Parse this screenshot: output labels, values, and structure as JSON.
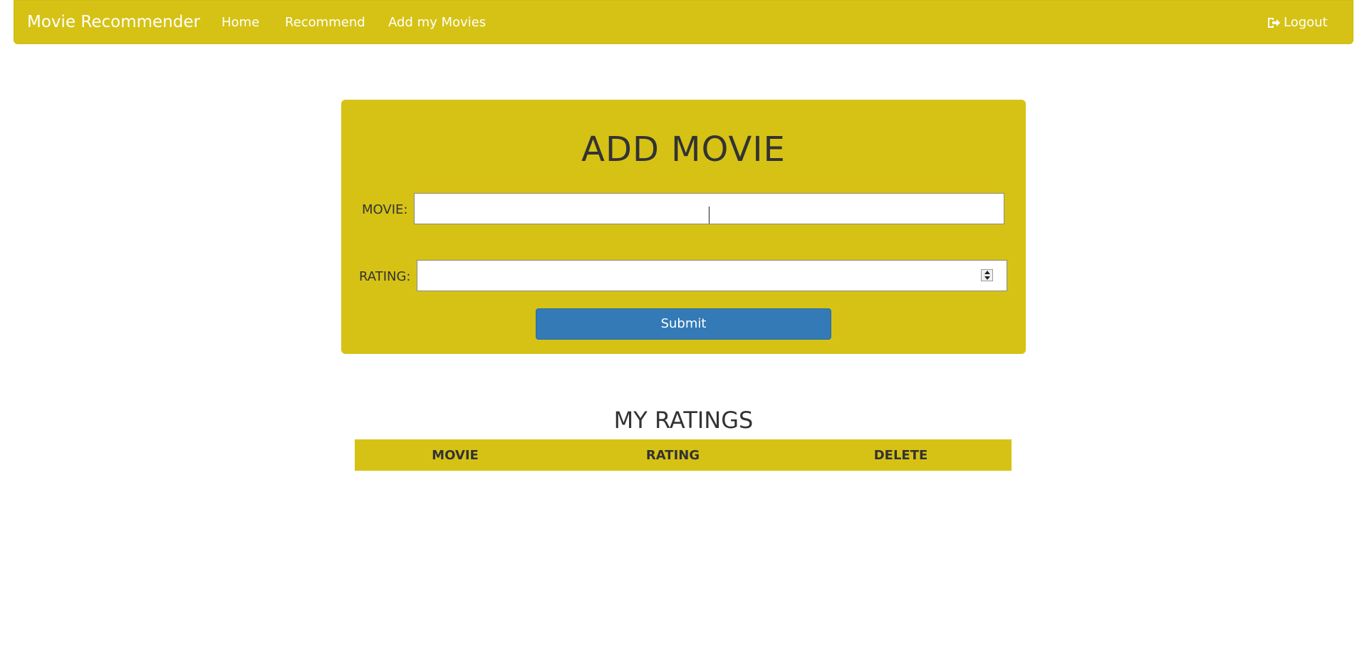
{
  "navbar": {
    "brand": "Movie Recommender",
    "links": [
      "Home",
      "Recommend",
      "Add my Movies"
    ],
    "logout": "Logout",
    "color": "#d6c215"
  },
  "form": {
    "title": "ADD MOVIE",
    "movie_label": "MOVIE:",
    "movie_value": "",
    "rating_label": "RATING:",
    "rating_value": "",
    "submit_label": "Submit",
    "submit_color": "#337ab7"
  },
  "ratings": {
    "title": "MY RATINGS",
    "columns": [
      "MOVIE",
      "RATING",
      "DELETE"
    ],
    "rows": []
  },
  "icons": {
    "logout": "logout-icon",
    "spinner": "number-spinner-icon"
  }
}
